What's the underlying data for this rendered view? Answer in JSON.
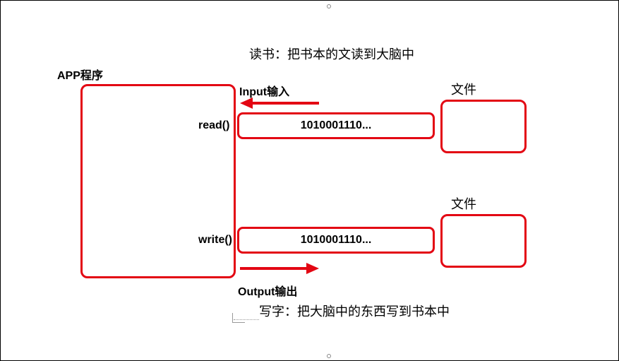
{
  "title_top": "读书：把书本的文读到大脑中",
  "title_bottom": "写字：把大脑中的东西写到书本中",
  "app_label": "APP程序",
  "input_label": "Input输入",
  "output_label": "Output输出",
  "read_fn": "read()",
  "write_fn": "write()",
  "file_label_top": "文件",
  "file_label_bottom": "文件",
  "data_stream_top": "1010001110...",
  "data_stream_bottom": "1010001110...",
  "colors": {
    "red": "#e30613"
  }
}
